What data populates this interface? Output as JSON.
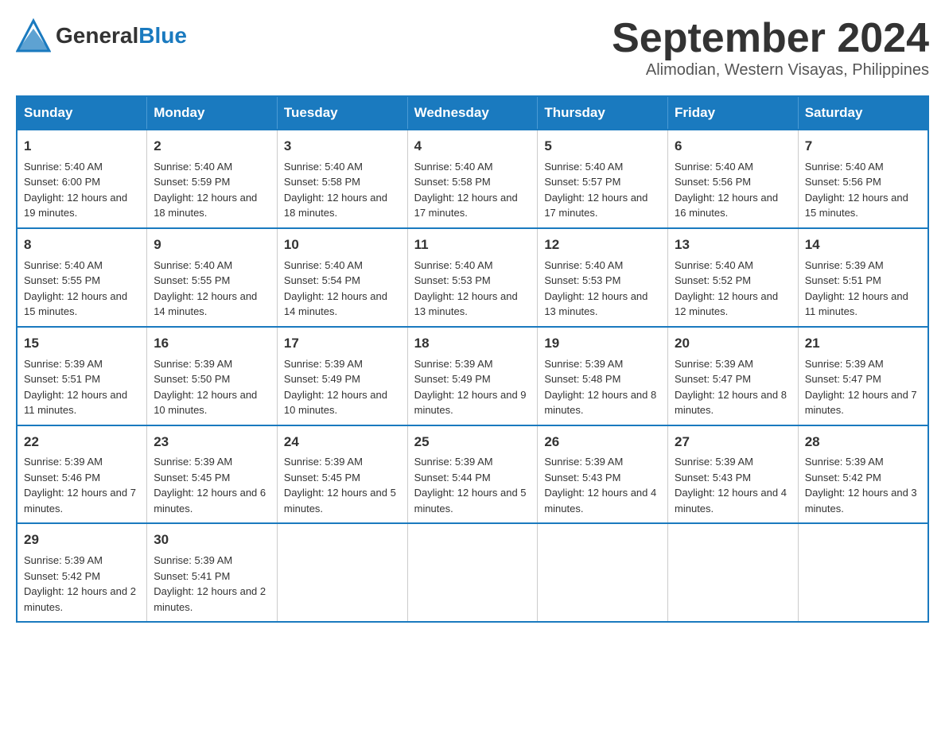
{
  "logo": {
    "general": "General",
    "blue": "Blue"
  },
  "title": "September 2024",
  "subtitle": "Alimodian, Western Visayas, Philippines",
  "days_of_week": [
    "Sunday",
    "Monday",
    "Tuesday",
    "Wednesday",
    "Thursday",
    "Friday",
    "Saturday"
  ],
  "weeks": [
    [
      {
        "day": "1",
        "sunrise": "Sunrise: 5:40 AM",
        "sunset": "Sunset: 6:00 PM",
        "daylight": "Daylight: 12 hours and 19 minutes."
      },
      {
        "day": "2",
        "sunrise": "Sunrise: 5:40 AM",
        "sunset": "Sunset: 5:59 PM",
        "daylight": "Daylight: 12 hours and 18 minutes."
      },
      {
        "day": "3",
        "sunrise": "Sunrise: 5:40 AM",
        "sunset": "Sunset: 5:58 PM",
        "daylight": "Daylight: 12 hours and 18 minutes."
      },
      {
        "day": "4",
        "sunrise": "Sunrise: 5:40 AM",
        "sunset": "Sunset: 5:58 PM",
        "daylight": "Daylight: 12 hours and 17 minutes."
      },
      {
        "day": "5",
        "sunrise": "Sunrise: 5:40 AM",
        "sunset": "Sunset: 5:57 PM",
        "daylight": "Daylight: 12 hours and 17 minutes."
      },
      {
        "day": "6",
        "sunrise": "Sunrise: 5:40 AM",
        "sunset": "Sunset: 5:56 PM",
        "daylight": "Daylight: 12 hours and 16 minutes."
      },
      {
        "day": "7",
        "sunrise": "Sunrise: 5:40 AM",
        "sunset": "Sunset: 5:56 PM",
        "daylight": "Daylight: 12 hours and 15 minutes."
      }
    ],
    [
      {
        "day": "8",
        "sunrise": "Sunrise: 5:40 AM",
        "sunset": "Sunset: 5:55 PM",
        "daylight": "Daylight: 12 hours and 15 minutes."
      },
      {
        "day": "9",
        "sunrise": "Sunrise: 5:40 AM",
        "sunset": "Sunset: 5:55 PM",
        "daylight": "Daylight: 12 hours and 14 minutes."
      },
      {
        "day": "10",
        "sunrise": "Sunrise: 5:40 AM",
        "sunset": "Sunset: 5:54 PM",
        "daylight": "Daylight: 12 hours and 14 minutes."
      },
      {
        "day": "11",
        "sunrise": "Sunrise: 5:40 AM",
        "sunset": "Sunset: 5:53 PM",
        "daylight": "Daylight: 12 hours and 13 minutes."
      },
      {
        "day": "12",
        "sunrise": "Sunrise: 5:40 AM",
        "sunset": "Sunset: 5:53 PM",
        "daylight": "Daylight: 12 hours and 13 minutes."
      },
      {
        "day": "13",
        "sunrise": "Sunrise: 5:40 AM",
        "sunset": "Sunset: 5:52 PM",
        "daylight": "Daylight: 12 hours and 12 minutes."
      },
      {
        "day": "14",
        "sunrise": "Sunrise: 5:39 AM",
        "sunset": "Sunset: 5:51 PM",
        "daylight": "Daylight: 12 hours and 11 minutes."
      }
    ],
    [
      {
        "day": "15",
        "sunrise": "Sunrise: 5:39 AM",
        "sunset": "Sunset: 5:51 PM",
        "daylight": "Daylight: 12 hours and 11 minutes."
      },
      {
        "day": "16",
        "sunrise": "Sunrise: 5:39 AM",
        "sunset": "Sunset: 5:50 PM",
        "daylight": "Daylight: 12 hours and 10 minutes."
      },
      {
        "day": "17",
        "sunrise": "Sunrise: 5:39 AM",
        "sunset": "Sunset: 5:49 PM",
        "daylight": "Daylight: 12 hours and 10 minutes."
      },
      {
        "day": "18",
        "sunrise": "Sunrise: 5:39 AM",
        "sunset": "Sunset: 5:49 PM",
        "daylight": "Daylight: 12 hours and 9 minutes."
      },
      {
        "day": "19",
        "sunrise": "Sunrise: 5:39 AM",
        "sunset": "Sunset: 5:48 PM",
        "daylight": "Daylight: 12 hours and 8 minutes."
      },
      {
        "day": "20",
        "sunrise": "Sunrise: 5:39 AM",
        "sunset": "Sunset: 5:47 PM",
        "daylight": "Daylight: 12 hours and 8 minutes."
      },
      {
        "day": "21",
        "sunrise": "Sunrise: 5:39 AM",
        "sunset": "Sunset: 5:47 PM",
        "daylight": "Daylight: 12 hours and 7 minutes."
      }
    ],
    [
      {
        "day": "22",
        "sunrise": "Sunrise: 5:39 AM",
        "sunset": "Sunset: 5:46 PM",
        "daylight": "Daylight: 12 hours and 7 minutes."
      },
      {
        "day": "23",
        "sunrise": "Sunrise: 5:39 AM",
        "sunset": "Sunset: 5:45 PM",
        "daylight": "Daylight: 12 hours and 6 minutes."
      },
      {
        "day": "24",
        "sunrise": "Sunrise: 5:39 AM",
        "sunset": "Sunset: 5:45 PM",
        "daylight": "Daylight: 12 hours and 5 minutes."
      },
      {
        "day": "25",
        "sunrise": "Sunrise: 5:39 AM",
        "sunset": "Sunset: 5:44 PM",
        "daylight": "Daylight: 12 hours and 5 minutes."
      },
      {
        "day": "26",
        "sunrise": "Sunrise: 5:39 AM",
        "sunset": "Sunset: 5:43 PM",
        "daylight": "Daylight: 12 hours and 4 minutes."
      },
      {
        "day": "27",
        "sunrise": "Sunrise: 5:39 AM",
        "sunset": "Sunset: 5:43 PM",
        "daylight": "Daylight: 12 hours and 4 minutes."
      },
      {
        "day": "28",
        "sunrise": "Sunrise: 5:39 AM",
        "sunset": "Sunset: 5:42 PM",
        "daylight": "Daylight: 12 hours and 3 minutes."
      }
    ],
    [
      {
        "day": "29",
        "sunrise": "Sunrise: 5:39 AM",
        "sunset": "Sunset: 5:42 PM",
        "daylight": "Daylight: 12 hours and 2 minutes."
      },
      {
        "day": "30",
        "sunrise": "Sunrise: 5:39 AM",
        "sunset": "Sunset: 5:41 PM",
        "daylight": "Daylight: 12 hours and 2 minutes."
      },
      null,
      null,
      null,
      null,
      null
    ]
  ]
}
